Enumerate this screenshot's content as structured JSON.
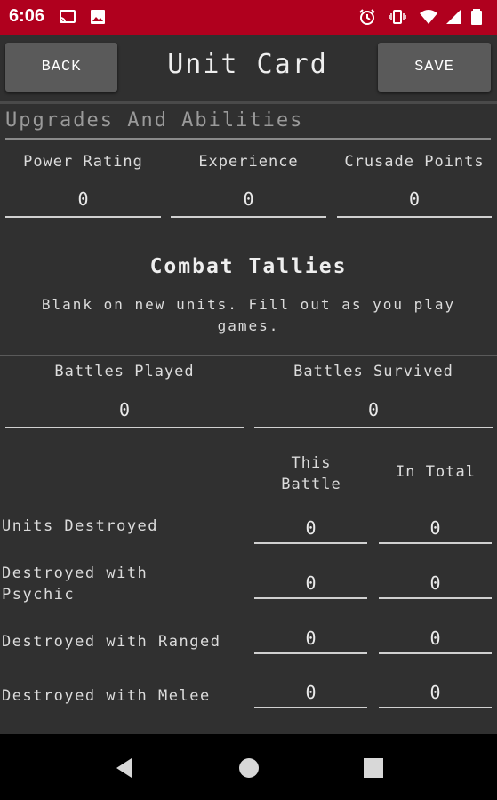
{
  "status_bar": {
    "time": "6:06",
    "left_icons": [
      "cast-icon",
      "image-icon"
    ],
    "right_icons": [
      "alarm-icon",
      "vibrate-icon",
      "wifi-icon",
      "signal-icon",
      "battery-icon"
    ]
  },
  "app_bar": {
    "back_label": "BACK",
    "title": "Unit Card",
    "save_label": "SAVE"
  },
  "upgrades": {
    "section_title": "Upgrades And Abilities",
    "power_rating": {
      "label": "Power Rating",
      "value": "0"
    },
    "experience": {
      "label": "Experience",
      "value": "0"
    },
    "crusade_points": {
      "label": "Crusade Points",
      "value": "0"
    }
  },
  "combat": {
    "title": "Combat Tallies",
    "description": "Blank on new units. Fill out as you play games.",
    "battles_played": {
      "label": "Battles Played",
      "value": "0"
    },
    "battles_survived": {
      "label": "Battles Survived",
      "value": "0"
    },
    "col_this_battle": "This Battle",
    "col_in_total": "In Total",
    "rows": [
      {
        "label": "Units Destroyed",
        "this_battle": "0",
        "in_total": "0"
      },
      {
        "label": "Destroyed with Psychic",
        "this_battle": "0",
        "in_total": "0"
      },
      {
        "label": "Destroyed with Ranged",
        "this_battle": "0",
        "in_total": "0"
      },
      {
        "label": "Destroyed with Melee",
        "this_battle": "0",
        "in_total": "0"
      }
    ]
  },
  "nav_bar": {
    "icons": [
      "back-triangle-icon",
      "home-circle-icon",
      "recents-square-icon"
    ]
  },
  "colors": {
    "status_bar": "#b0001e",
    "background": "#303030",
    "button": "#5a5a5a",
    "nav_bar": "#000000"
  }
}
